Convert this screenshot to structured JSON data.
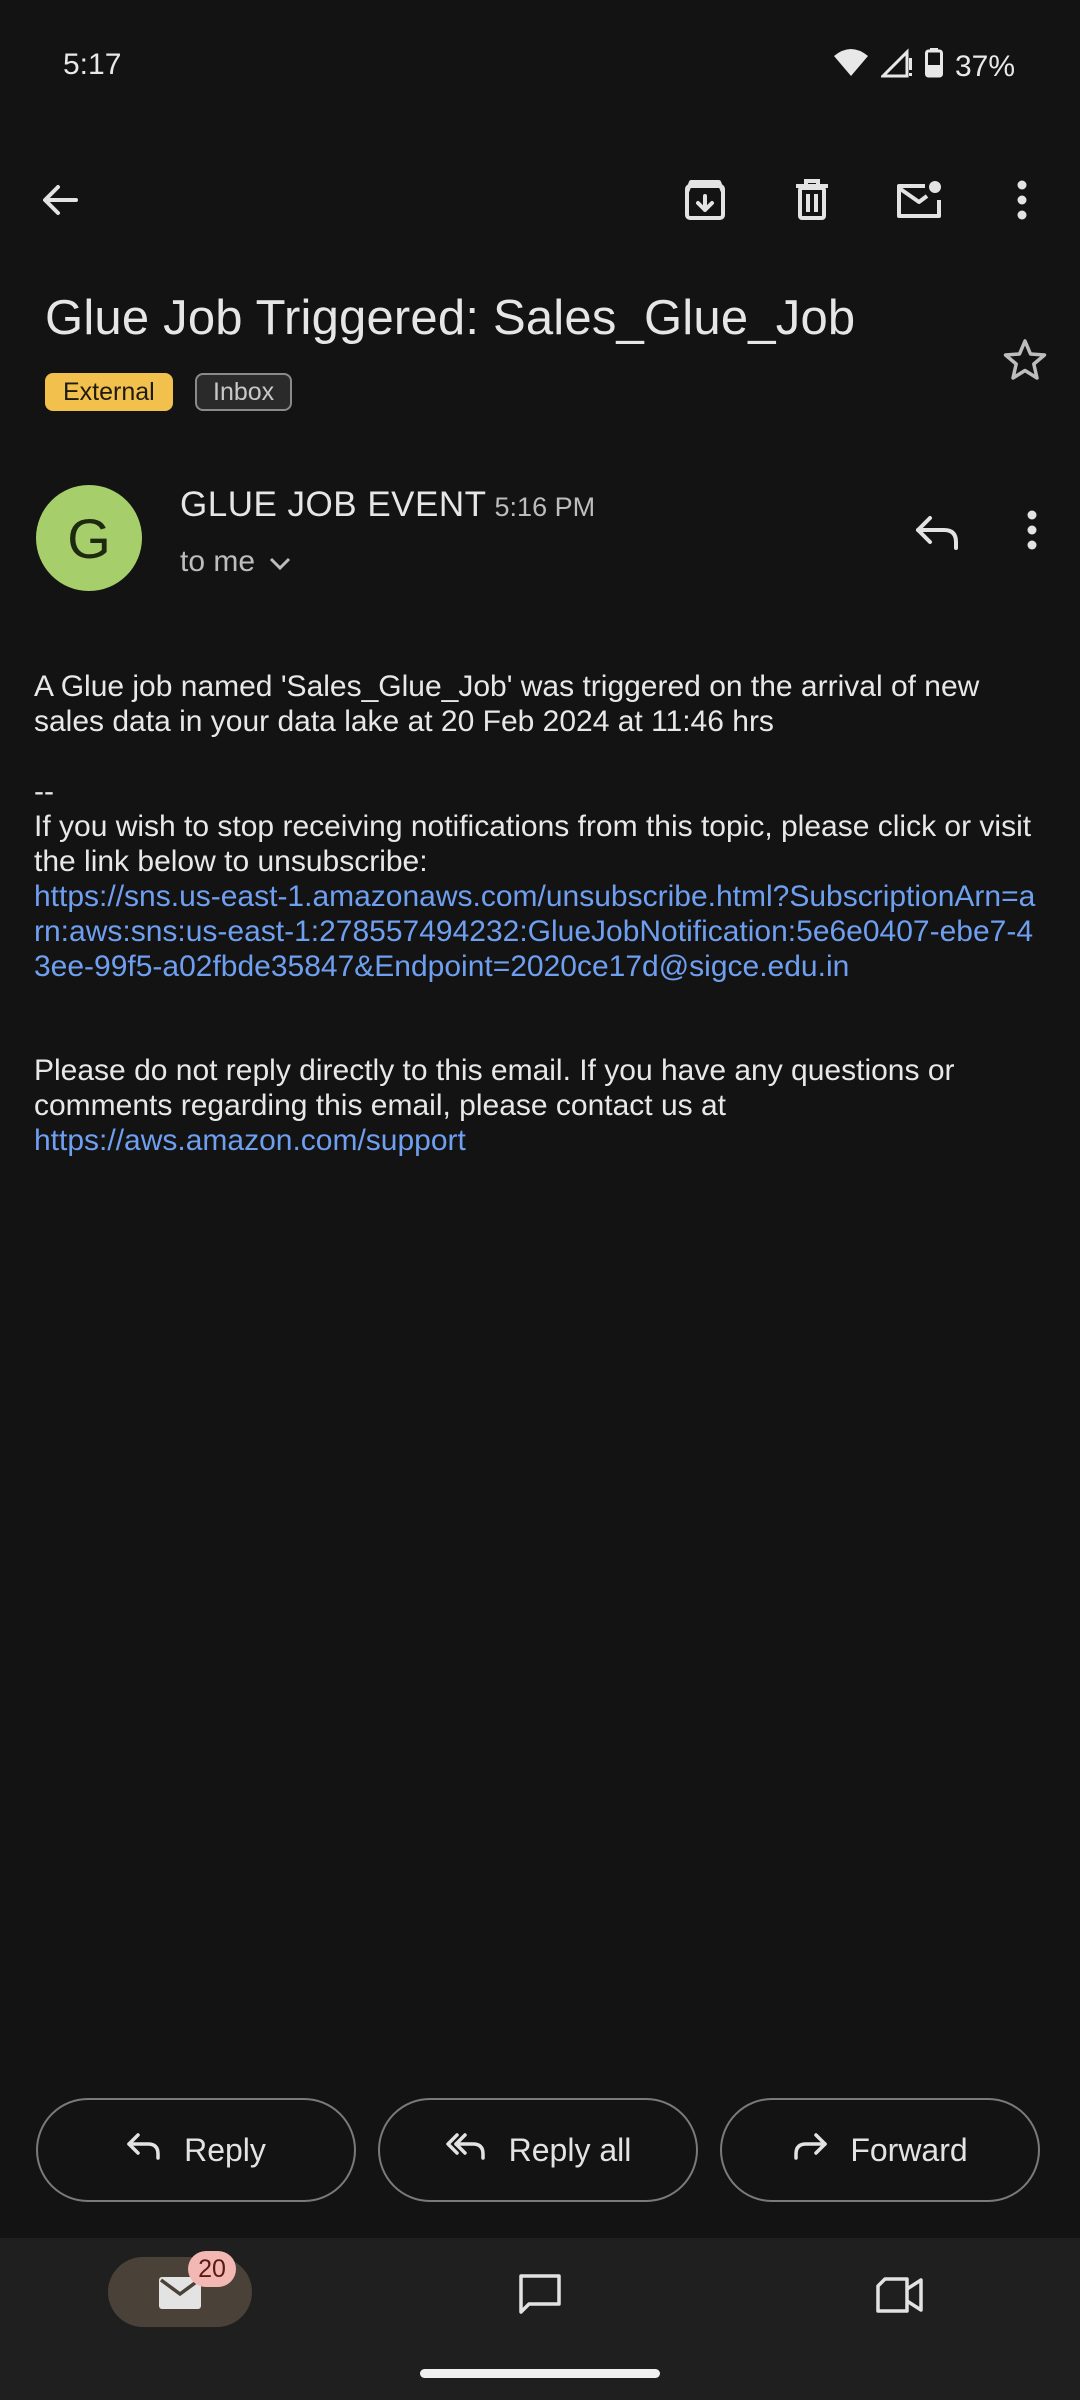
{
  "status_bar": {
    "time": "5:17",
    "battery": "37%",
    "icons": [
      "wifi-icon",
      "signal-icon",
      "battery-icon"
    ]
  },
  "toolbar": {
    "icons": [
      "back-arrow-icon",
      "archive-icon",
      "delete-icon",
      "mark-unread-icon",
      "more-vert-icon"
    ]
  },
  "email": {
    "subject": "Glue Job Triggered: Sales_Glue_Job",
    "labels": [
      "External",
      "Inbox"
    ],
    "sender_initial": "G",
    "sender_name": "GLUE JOB EVENT",
    "time": "5:16 PM",
    "recipient_line": "to me",
    "body": {
      "line1": "A Glue job named 'Sales_Glue_Job' was triggered on the arrival of new sales data in your data lake at 20 Feb 2024 at 11:46 hrs",
      "separator": "--",
      "unsubscribe_text": "If you wish to stop receiving notifications from this topic, please click or visit the link below to unsubscribe:",
      "unsubscribe_link": "https://sns.us-east-1.amazonaws.com/unsubscribe.html?SubscriptionArn=arn:aws:sns:us-east-1:278557494232:GlueJobNotification:5e6e0407-ebe7-43ee-99f5-a02fbde35847&Endpoint=2020ce17d@sigce.edu.in",
      "contact_text": "Please do not reply directly to this email. If you have any questions or comments regarding this email, please contact us at",
      "support_link": "https://aws.amazon.com/support"
    }
  },
  "actions": {
    "reply": "Reply",
    "reply_all": "Reply all",
    "forward": "Forward"
  },
  "bottom_nav": {
    "mail_badge": "20",
    "items": [
      "mail-icon",
      "chat-icon",
      "meet-icon"
    ]
  },
  "colors": {
    "background": "#131313",
    "external_label": "#f2c04c",
    "avatar": "#a6cf6b",
    "link": "#6f9ff0"
  }
}
